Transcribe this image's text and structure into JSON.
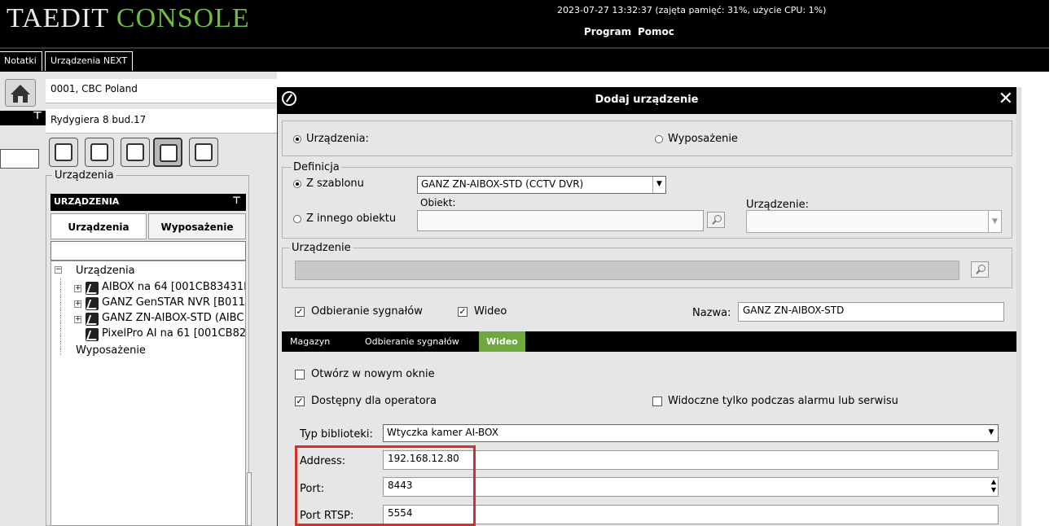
{
  "app": {
    "title_prefix": "TAEDIT",
    "title_suffix": "CONSOLE",
    "status": "2023-07-27 13:32:37 (zajęta pamięć: 31%, użycie CPU: 1%)",
    "menu": [
      "Program",
      "Pomoc"
    ],
    "top_tabs": [
      "Notatki",
      "Urządzenia NEXT"
    ]
  },
  "sidebar": {
    "org": "0001, CBC Poland",
    "address": "Rydygiera 8 bud.17",
    "group_label": "Urządzenia",
    "panel_title": "URZĄDZENIA",
    "tabs": [
      "Urządzenia",
      "Wyposażenie"
    ],
    "tree": {
      "root": "Urządzenia",
      "items": [
        "AIBOX na 64 [001CB83431I",
        "GANZ GenSTAR NVR [B011",
        "GANZ ZN-AIBOX-STD (AIBC",
        "PixelPro AI na 61 [001CB82"
      ],
      "second_root": "Wyposażenie"
    }
  },
  "dialog": {
    "title": "Dodaj urządzenie",
    "type_radio_1": "Urządzenia:",
    "type_radio_2": "Wyposażenie",
    "definicja_label": "Definicja",
    "z_szablonu": "Z szablonu",
    "template_value": "GANZ ZN-AIBOX-STD (CCTV DVR)",
    "z_innego": "Z innego obiektu",
    "obiekt_label": "Obiekt:",
    "urzadzenie_label": "Urządzenie:",
    "urzadzenie_group": "Urządzenie",
    "odbieranie_sygnalow": "Odbieranie sygnałów",
    "wideo_check": "Wideo",
    "nazwa_label": "Nazwa:",
    "nazwa_value": "GANZ ZN-AIBOX-STD",
    "tabs": [
      "Magazyn",
      "Odbieranie sygnałów",
      "Wideo"
    ],
    "otworz": "Otwórz w nowym oknie",
    "dostepny": "Dostępny dla operatora",
    "widoczne": "Widoczne tylko podczas alarmu lub serwisu",
    "typ_label": "Typ biblioteki:",
    "typ_value": "Wtyczka kamer AI-BOX",
    "address_label": "Address:",
    "address_value": "192.168.12.80",
    "port_label": "Port:",
    "port_value": "8443",
    "rtsp_label": "Port RTSP:",
    "rtsp_value": "5554"
  },
  "colors": {
    "accent": "#6ea93e",
    "highlight": "#d32f2f",
    "bar": "#000000"
  }
}
